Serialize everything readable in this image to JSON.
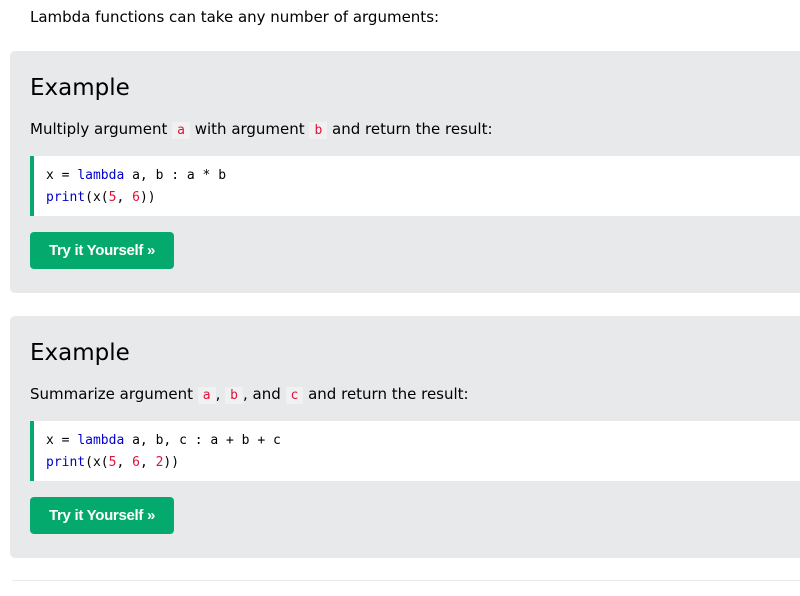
{
  "intro_text": "Lambda functions can take any number of arguments:",
  "examples": [
    {
      "title": "Example",
      "desc_prefix": "Multiply argument ",
      "var_a": "a",
      "desc_mid": " with argument ",
      "var_b": "b",
      "desc_suffix": " and return the result:",
      "code_line1_a": "x = ",
      "code_line1_kw": "lambda",
      "code_line1_b": " a, b : a * b",
      "code_line2_fn": "print",
      "code_line2_a": "(x(",
      "code_line2_n1": "5",
      "code_line2_sep1": ", ",
      "code_line2_n2": "6",
      "code_line2_end": "))",
      "button_label": "Try it Yourself »"
    },
    {
      "title": "Example",
      "desc_prefix": "Summarize argument ",
      "var_a": "a",
      "sep1": ", ",
      "var_b": "b",
      "sep2": ", and ",
      "var_c": "c",
      "desc_suffix": " and return the result:",
      "code_line1_a": "x = ",
      "code_line1_kw": "lambda",
      "code_line1_b": " a, b, c : a + b + c",
      "code_line2_fn": "print",
      "code_line2_a": "(x(",
      "code_line2_n1": "5",
      "code_line2_sep1": ", ",
      "code_line2_n2": "6",
      "code_line2_sep2": ", ",
      "code_line2_n3": "2",
      "code_line2_end": "))",
      "button_label": "Try it Yourself »"
    }
  ],
  "colors": {
    "accent_green": "#04aa6d",
    "box_background": "#e7e9eb",
    "code_keyword": "#0000cd",
    "code_number": "#dc143c"
  }
}
